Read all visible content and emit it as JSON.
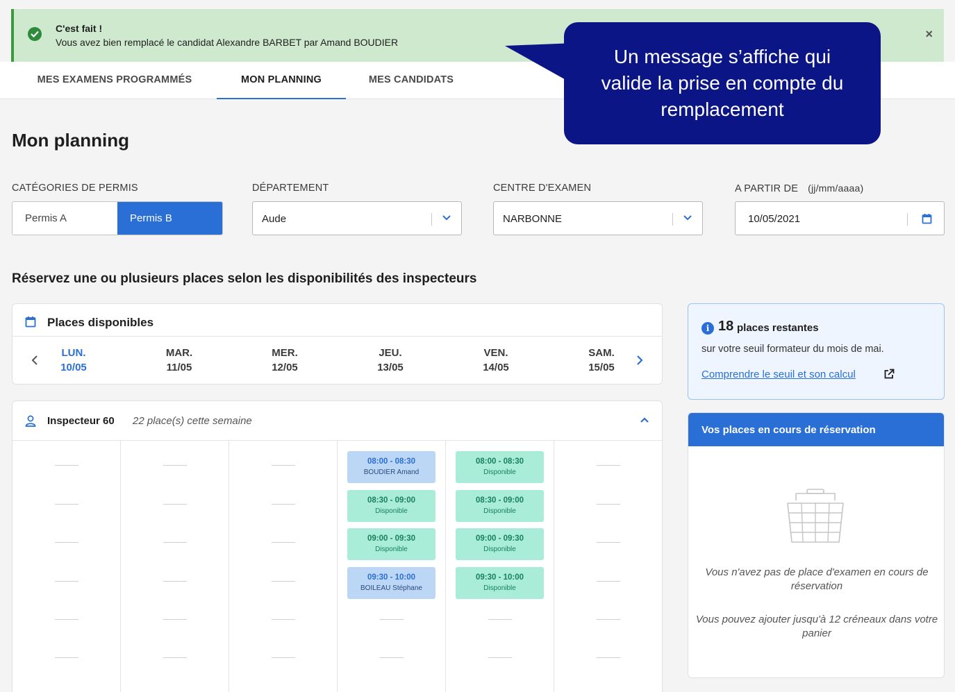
{
  "toast": {
    "title": "C'est fait !",
    "message": "Vous avez bien remplacé le candidat Alexandre BARBET par Amand BOUDIER",
    "close": "×"
  },
  "tabs": [
    {
      "label": "MES EXAMENS PROGRAMMÉS",
      "active": false
    },
    {
      "label": "MON PLANNING",
      "active": true
    },
    {
      "label": "MES CANDIDATS",
      "active": false
    }
  ],
  "callout": {
    "line1": "Un message s’affiche qui",
    "line2": "valide la prise en compte du",
    "line3": "remplacement"
  },
  "page_title": "Mon planning",
  "filters": {
    "category": {
      "label": "CATÉGORIES DE PERMIS",
      "options": [
        "Permis A",
        "Permis B"
      ],
      "selected": "Permis B"
    },
    "department": {
      "label": "DÉPARTEMENT",
      "value": "Aude"
    },
    "center": {
      "label": "CENTRE D'EXAMEN",
      "value": "NARBONNE"
    },
    "date": {
      "label": "A PARTIR DE",
      "hint": "(jj/mm/aaaa)",
      "value": "10/05/2021"
    }
  },
  "section_title": "Réservez une ou plusieurs places selon les disponibilités des inspecteurs",
  "calendar": {
    "title": "Places disponibles",
    "days": [
      {
        "name": "LUN.",
        "date": "10/05"
      },
      {
        "name": "MAR.",
        "date": "11/05"
      },
      {
        "name": "MER.",
        "date": "12/05"
      },
      {
        "name": "JEU.",
        "date": "13/05"
      },
      {
        "name": "VEN.",
        "date": "14/05"
      },
      {
        "name": "SAM.",
        "date": "15/05"
      }
    ],
    "prev": "‹",
    "next": "›"
  },
  "inspector": {
    "name": "Inspecteur 60",
    "count": "22 place(s) cette semaine",
    "thursday": [
      {
        "time": "08:00 - 08:30",
        "status": "BOUDIER Amand",
        "type": "booked"
      },
      {
        "time": "08:30 - 09:00",
        "status": "Disponible",
        "type": "free"
      },
      {
        "time": "09:00 - 09:30",
        "status": "Disponible",
        "type": "free"
      },
      {
        "time": "09:30 - 10:00",
        "status": "BOILEAU Stéphane",
        "type": "booked"
      }
    ],
    "friday": [
      {
        "time": "08:00 - 08:30",
        "status": "Disponible",
        "type": "free"
      },
      {
        "time": "08:30 - 09:00",
        "status": "Disponible",
        "type": "free"
      },
      {
        "time": "09:00 - 09:30",
        "status": "Disponible",
        "type": "free"
      },
      {
        "time": "09:30 - 10:00",
        "status": "Disponible",
        "type": "free"
      }
    ]
  },
  "info": {
    "icon": "i",
    "count": "18",
    "count_label": "places restantes",
    "subtitle": "sur votre seuil formateur du mois de mai.",
    "link": "Comprendre le seuil et son calcul"
  },
  "reservation": {
    "title": "Vos places en cours de réservation",
    "empty": "Vous n'avez pas de place d'examen en cours de réservation",
    "max": "Vous pouvez ajouter jusqu'à 12 créneaux dans votre panier"
  },
  "colors": {
    "accent": "#2a6fd6",
    "success_bg": "#cfe9cf",
    "callout_bg": "#0b1585",
    "slot_free": "#a9ecd8",
    "slot_booked": "#bcd6f5"
  },
  "icons": [
    "check-circle-icon",
    "close-icon",
    "chevron-down-icon",
    "calendar-icon",
    "chevron-left-icon",
    "chevron-right-icon",
    "user-icon",
    "chevron-up-icon",
    "info-icon",
    "external-link-icon",
    "basket-icon"
  ]
}
